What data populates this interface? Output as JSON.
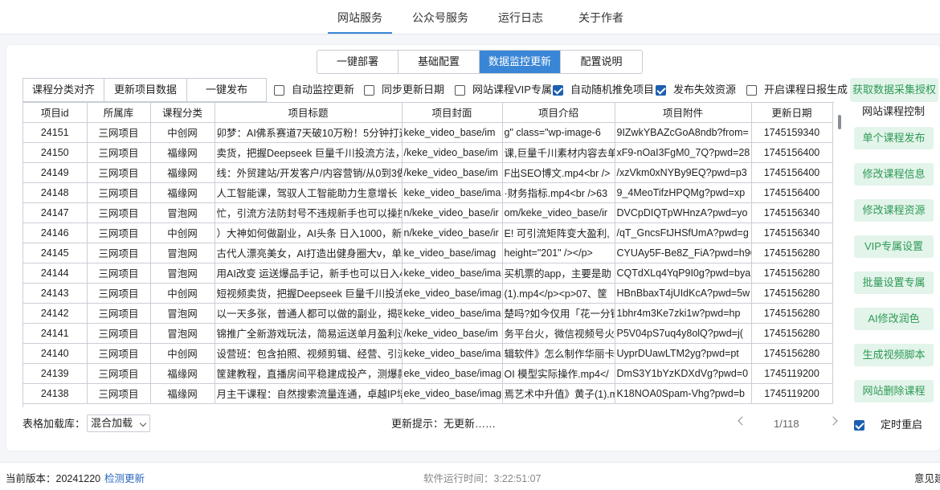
{
  "topnav": {
    "items": [
      {
        "label": "网站服务",
        "active": true
      },
      {
        "label": "公众号服务",
        "active": false
      },
      {
        "label": "运行日志",
        "active": false
      },
      {
        "label": "关于作者",
        "active": false
      }
    ]
  },
  "subtabs": [
    {
      "label": "一键部署",
      "active": false
    },
    {
      "label": "基础配置",
      "active": false
    },
    {
      "label": "数据监控更新",
      "active": true
    },
    {
      "label": "配置说明",
      "active": false
    }
  ],
  "toolbar": {
    "align_label": "课程分类对齐",
    "update_label": "更新项目数据",
    "publish_label": "一键发布",
    "checkboxes": [
      {
        "label": "自动监控更新",
        "checked": false
      },
      {
        "label": "同步更新日期",
        "checked": false
      },
      {
        "label": "网站课程VIP专属",
        "checked": false
      },
      {
        "label": "自动随机推免项目",
        "checked": true
      },
      {
        "label": "发布失效资源",
        "checked": true
      },
      {
        "label": "开启课程日报生成",
        "checked": false
      }
    ],
    "auth_label": "获取数据采集授权"
  },
  "table": {
    "columns": [
      "项目id",
      "所属库",
      "课程分类",
      "项目标题",
      "项目封面",
      "项目介绍",
      "项目附件",
      "更新日期"
    ],
    "rows": [
      [
        "24151",
        "三网项目",
        "中创网",
        "卯梦：AI佛系赛道7天破10万粉！5分钟打造",
        "keke_video_base/im",
        "g\"   class=\"wp-image-6",
        "9IZwkYBAZcGoA8ndb?from=",
        "1745159340"
      ],
      [
        "24150",
        "三网项目",
        "福缘网",
        "卖货，把握Deepseek 巨量千川投流方法，",
        "/keke_video_base/im",
        "课,巨量千川素材内容去单",
        "xF9-nOaI3FgM0_7Q?pwd=28",
        "1745156400"
      ],
      [
        "24149",
        "三网项目",
        "福缘网",
        "线：外贸建站/开发客户/内容营销/从0到3做",
        "/keke_video_base/im",
        "F出SEO博文.mp4<br />",
        "/xzVkm0xNYBy9EQ?pwd=p3",
        "1745156400"
      ],
      [
        "24148",
        "三网项目",
        "福缘网",
        "人工智能课，驾驭人工智能助力生意增长（",
        "keke_video_base/ima",
        "·财务指标.mp4<br />63",
        "9_4MeoTifzHPQMg?pwd=xp",
        "1745156400"
      ],
      [
        "24147",
        "三网项目",
        "冒泡网",
        "忙，引流方法防封号不违规新手也可以操控，",
        "n/keke_video_base/ir",
        "om/keke_video_base/ir",
        "DVCpDIQTpWHnzA?pwd=yo",
        "1745156340"
      ],
      [
        "24146",
        "三网项目",
        "中创网",
        "）大神如何做副业，AI头条 日入1000，新",
        "n/keke_video_base/ir",
        "E! 可引流矩阵变大盈利,",
        "/qT_GncsFtJHSfUmA?pwd=g",
        "1745156340"
      ],
      [
        "24145",
        "三网项目",
        "冒泡网",
        "古代人漂亮美女，AI打造出健身圈大v，单",
        "ke_video_base/imag",
        "height=\"201\" /></p>",
        "CYUAy5F-Be8Z_FiA?pwd=h96",
        "1745156280"
      ],
      [
        "24144",
        "三网项目",
        "冒泡网",
        "用AI改变 运送爆品手记，新手也可以日入45",
        "keke_video_base/ima",
        "买机票的app，主要是助",
        "CQTdXLq4YqP9I0g?pwd=bya",
        "1745156280"
      ],
      [
        "24143",
        "三网项目",
        "中创网",
        "短视频卖货，把握Deepseek 巨量千川投流",
        "eke_video_base/imag",
        "(1).mp4</p><p>07、筐",
        "HBnBbaxT4jUIdKcA?pwd=5w",
        "1745156280"
      ],
      [
        "24142",
        "三网项目",
        "冒泡网",
        "以一天多张，普通人都可以做的副业，揭密",
        "keke_video_base/ima",
        "楚吗?如今仅用「花一分钟",
        "1bhr4m3Ke7zki1w?pwd=hp",
        "1745156280"
      ],
      [
        "24141",
        "三网项目",
        "冒泡网",
        "锦推广全新游戏玩法，简易运送单月盈利过W",
        "/keke_video_base/im",
        "务平台火，微信视频号火,",
        "P5V04pS7uq4y8olQ?pwd=j(",
        "1745156280"
      ],
      [
        "24140",
        "三网项目",
        "中创网",
        "设营班：包含拍照、视频剪辑、经营、引流",
        "keke_video_base/ima",
        "辑软件》怎么制作华丽卡",
        "UyprDUawLTM2yg?pwd=pt",
        "1745156280"
      ],
      [
        "24139",
        "三网项目",
        "福缘网",
        "筐建教程，直播房间平稳建成投产，测爆款",
        "eke_video_base/imag",
        "OI 模型实际操作.mp4</",
        "DmS3Y1bYzKDXdVg?pwd=0",
        "1745119200"
      ],
      [
        "24138",
        "三网项目",
        "福缘网",
        "月主干课程：自然搜索流量连通，卓越IP培",
        "eke_video_base/imag",
        "焉艺术中升值》黄子(1).m",
        "K18NOA0Spam-Vhg?pwd=b",
        "1745119200"
      ]
    ]
  },
  "side": {
    "title": "网站课程控制",
    "buttons": [
      "单个课程发布",
      "修改课程信息",
      "修改课程资源",
      "VIP专属设置",
      "批量设置专属",
      "AI修改润色",
      "生成视频脚本",
      "网站删除课程"
    ]
  },
  "footer": {
    "loader_label": "表格加载库：",
    "loader_value": "混合加载",
    "hint": "更新提示：无更新……",
    "page": "1/118",
    "timer_label": "定时重启",
    "timer_checked": true
  },
  "status": {
    "version": "当前版本：20241220",
    "check_update": "检测更新",
    "runtime": "软件运行时间：3:22:51:07",
    "feedback": "意见建"
  }
}
